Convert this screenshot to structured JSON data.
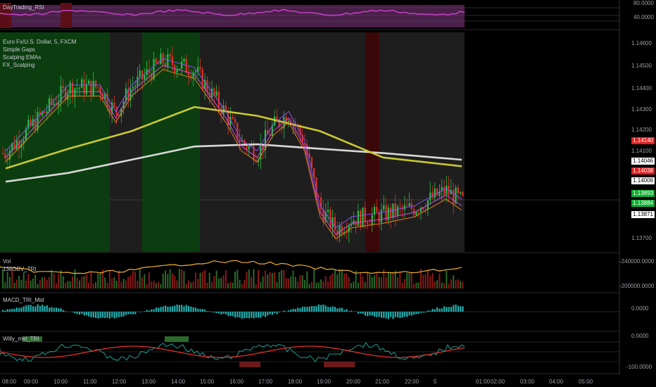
{
  "rsi_pane": {
    "title": "DayTrading_RSI",
    "axis": [
      "80.0000",
      "40.0000"
    ]
  },
  "main_pane": {
    "title": "Euro Fx/U.S. Dollar, 5, FXCM",
    "indicators": [
      "Simple Gaps",
      "Scalping EMAs",
      "FX_Scalping"
    ],
    "price_axis": [
      "1.14600",
      "1.14500",
      "1.14400",
      "1.14300",
      "1.14200",
      "1.14100",
      "1.13700"
    ],
    "tags": [
      {
        "text": "1.14140",
        "bg": "#e02020",
        "fg": "#ffffff"
      },
      {
        "text": "1.14046",
        "bg": "#ffffff",
        "fg": "#000000"
      },
      {
        "text": "1.14038",
        "bg": "#e02020",
        "fg": "#ffffff"
      },
      {
        "text": "1.14006",
        "bg": "#ffffff",
        "fg": "#000000"
      },
      {
        "text": "1.13893",
        "bg": "#10b030",
        "fg": "#ffffff"
      },
      {
        "text": "1.13884",
        "bg": "#10b030",
        "fg": "#ffffff"
      },
      {
        "text": "1.13871",
        "bg": "#ffffff",
        "fg": "#000000"
      }
    ]
  },
  "volume_pane": {
    "titles": [
      "Vol",
      "13eOBV_TRI"
    ],
    "axis": [
      "-240000.0000",
      "-200000.0000"
    ]
  },
  "macd_pane": {
    "title": "MACD_TRI_Mid",
    "axis": [
      "0.0000"
    ]
  },
  "willy_pane": {
    "title": "Willy_mid_TRI",
    "axis": [
      "0.0000",
      "-100.0000"
    ]
  },
  "time_axis": [
    "08:00",
    "09:00",
    "10:00",
    "11:00",
    "12:00",
    "13:00",
    "14:00",
    "15:00",
    "16:00",
    "17:00",
    "18:00",
    "19:00",
    "20:00",
    "21:00",
    "22:00",
    "5",
    "01:00",
    "02:00",
    "03:00",
    "04:00",
    "05:00"
  ],
  "colors": {
    "bull": "#26c04a",
    "bear": "#e0302a",
    "ema_fast": "#8a4df0",
    "ema_mid": "#d24ad8",
    "ema_slow": "#e07a20",
    "ma_yellow": "#c8c832",
    "ma_white": "#d8d8d8",
    "rsi_line": "#c040c0",
    "green_session": "#0b3d10",
    "red_session": "#3a0808",
    "obv_line": "#f0b030",
    "macd_hist": "#20b0b0",
    "willy_fast": "#20b0a0",
    "willy_slow": "#e03030"
  },
  "chart_data": {
    "type": "candlestick",
    "symbol": "Euro Fx/U.S. Dollar",
    "timeframe": "5",
    "x_range": [
      "08:00",
      "22:30"
    ],
    "price_ylim": [
      1.1365,
      1.1465
    ],
    "close_path": [
      {
        "x": "08:00",
        "y": 1.141
      },
      {
        "x": "09:00",
        "y": 1.1425
      },
      {
        "x": "10:00",
        "y": 1.144
      },
      {
        "x": "11:00",
        "y": 1.144
      },
      {
        "x": "11:30",
        "y": 1.1428
      },
      {
        "x": "12:00",
        "y": 1.144
      },
      {
        "x": "13:00",
        "y": 1.1452
      },
      {
        "x": "14:00",
        "y": 1.1448
      },
      {
        "x": "15:00",
        "y": 1.1428
      },
      {
        "x": "15:30",
        "y": 1.1415
      },
      {
        "x": "16:00",
        "y": 1.141
      },
      {
        "x": "16:30",
        "y": 1.1422
      },
      {
        "x": "17:00",
        "y": 1.1428
      },
      {
        "x": "17:30",
        "y": 1.1415
      },
      {
        "x": "18:00",
        "y": 1.1385
      },
      {
        "x": "18:30",
        "y": 1.1375
      },
      {
        "x": "19:00",
        "y": 1.138
      },
      {
        "x": "20:00",
        "y": 1.1382
      },
      {
        "x": "21:00",
        "y": 1.1385
      },
      {
        "x": "22:00",
        "y": 1.1393
      },
      {
        "x": "22:30",
        "y": 1.1388
      }
    ],
    "ma_yellow_path": [
      {
        "x": "08:00",
        "y": 1.1403
      },
      {
        "x": "10:00",
        "y": 1.1412
      },
      {
        "x": "12:00",
        "y": 1.142
      },
      {
        "x": "14:00",
        "y": 1.1431
      },
      {
        "x": "16:00",
        "y": 1.1427
      },
      {
        "x": "18:00",
        "y": 1.142
      },
      {
        "x": "20:00",
        "y": 1.1408
      },
      {
        "x": "22:30",
        "y": 1.1404
      }
    ],
    "ma_white_path": [
      {
        "x": "08:00",
        "y": 1.1397
      },
      {
        "x": "10:00",
        "y": 1.1401
      },
      {
        "x": "12:00",
        "y": 1.1407
      },
      {
        "x": "14:00",
        "y": 1.1413
      },
      {
        "x": "16:00",
        "y": 1.1414
      },
      {
        "x": "18:00",
        "y": 1.1412
      },
      {
        "x": "20:00",
        "y": 1.141
      },
      {
        "x": "22:30",
        "y": 1.1407
      }
    ]
  }
}
